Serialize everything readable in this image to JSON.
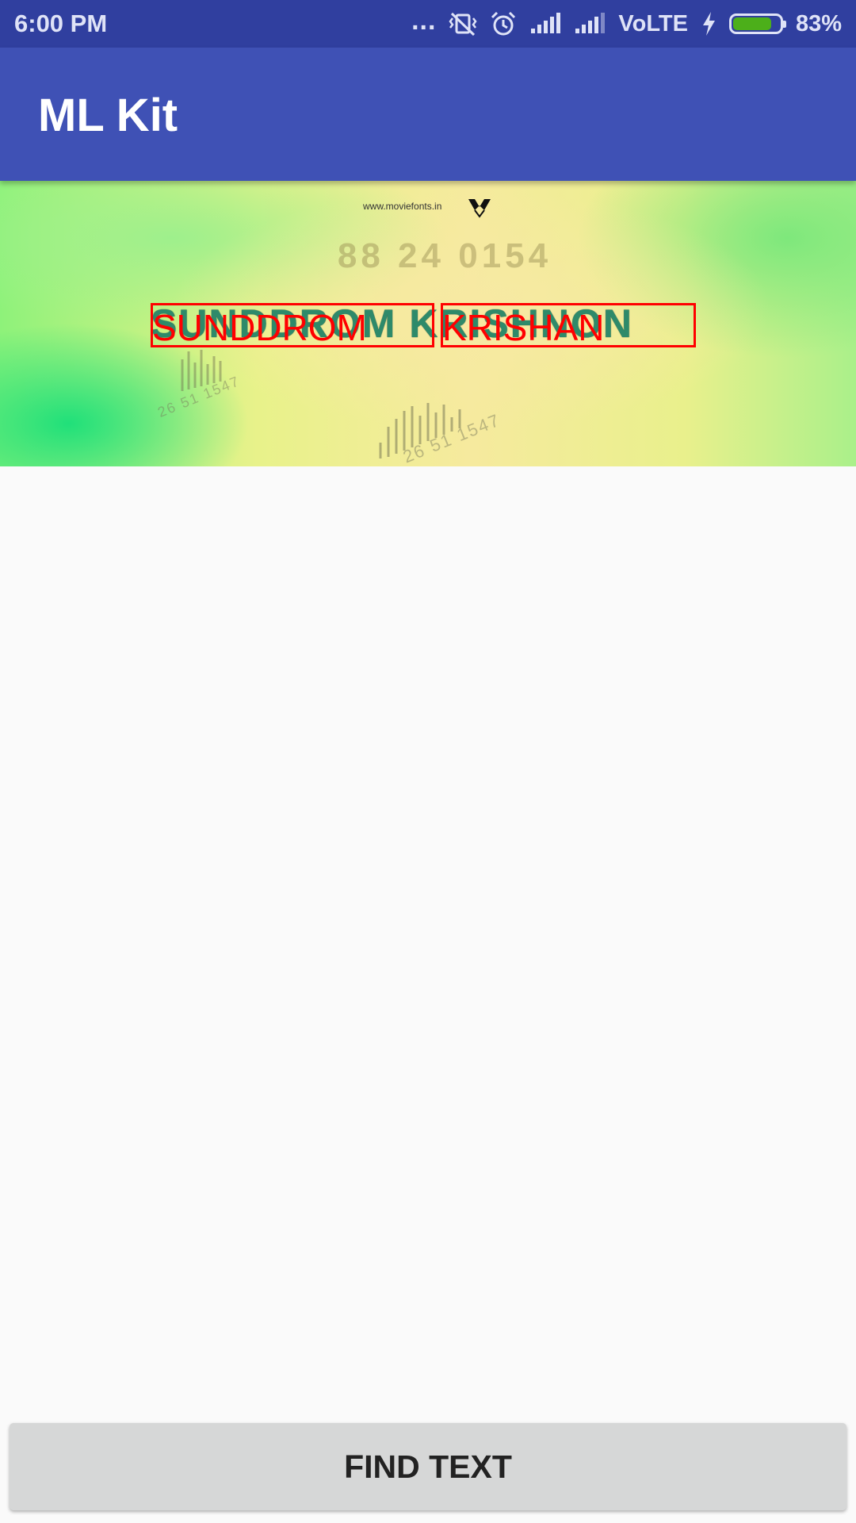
{
  "status_bar": {
    "time": "6:00 PM",
    "dots": "...",
    "network": "VoLTE",
    "battery_percent": "83%",
    "battery_level": 0.83,
    "battery_color": "#4caf1a",
    "icons": [
      "more-dots-icon",
      "vibrate-off-icon",
      "alarm-icon",
      "signal-icon",
      "signal-icon",
      "charging-bolt-icon",
      "battery-icon"
    ]
  },
  "app_bar": {
    "title": "ML Kit",
    "color": "#3f51b5"
  },
  "preview": {
    "website": "www.moviefonts.in",
    "number": "88 24 0154",
    "poster_title": "SUNDDROM KRISHNON",
    "barcode_text_1": "26 51 1547",
    "barcode_text_2": "26 51 1547",
    "detected_text": [
      "SUNDDROM",
      "KRISHAN"
    ],
    "box_color": "#ff0000"
  },
  "actions": {
    "find_text_label": "FIND TEXT"
  }
}
